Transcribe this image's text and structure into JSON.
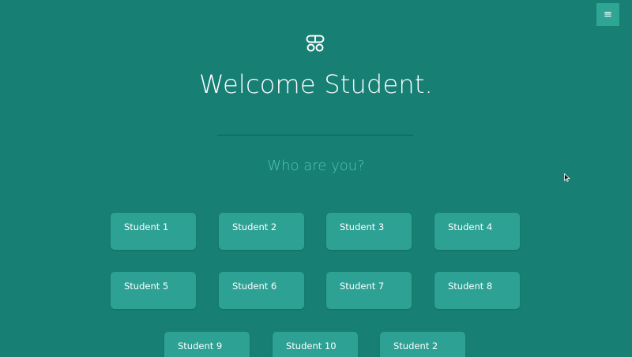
{
  "header": {
    "menu_icon": "≡",
    "logo_icon": "app-logo-icon"
  },
  "main": {
    "title": "Welcome Student.",
    "subtitle": "Who are you?",
    "students": [
      {
        "label": "Student 1"
      },
      {
        "label": "Student 2"
      },
      {
        "label": "Student 3"
      },
      {
        "label": "Student 4"
      },
      {
        "label": "Student 5"
      },
      {
        "label": "Student 6"
      },
      {
        "label": "Student 7"
      },
      {
        "label": "Student 8"
      },
      {
        "label": "Student 9"
      },
      {
        "label": "Student 10"
      },
      {
        "label": "Student 2"
      }
    ]
  },
  "colors": {
    "background": "#177f74",
    "card": "#2ea195",
    "accent_text": "#52c4b5",
    "menu_button": "#2ea595"
  }
}
